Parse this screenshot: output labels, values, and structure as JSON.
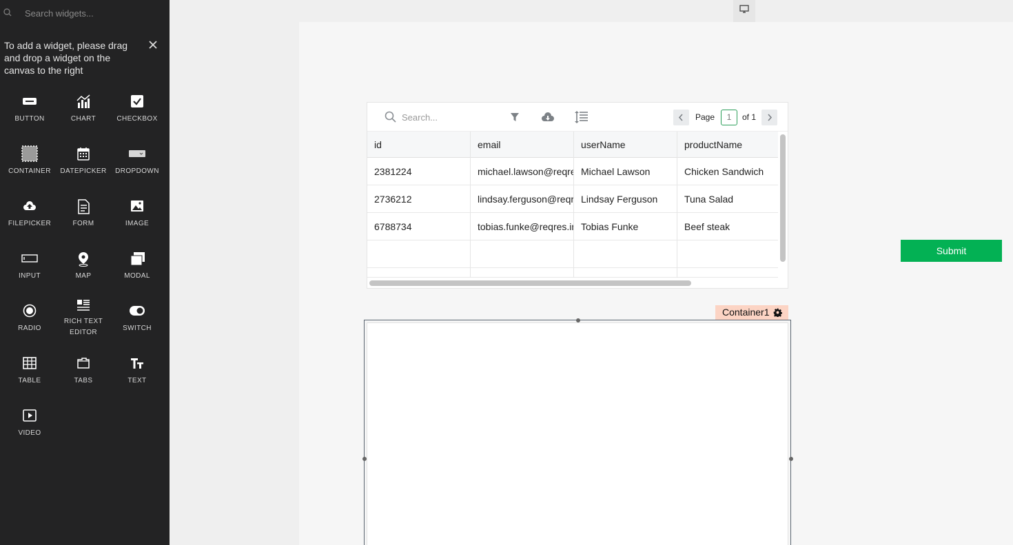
{
  "sidebar": {
    "search_placeholder": "Search widgets...",
    "hint": "To add a widget, please drag and drop a widget on the canvas to the right",
    "widgets": [
      {
        "label": "BUTTON",
        "icon": "button-icon"
      },
      {
        "label": "CHART",
        "icon": "chart-icon"
      },
      {
        "label": "CHECKBOX",
        "icon": "checkbox-icon"
      },
      {
        "label": "CONTAINER",
        "icon": "container-icon"
      },
      {
        "label": "DATEPICKER",
        "icon": "calendar-icon"
      },
      {
        "label": "DROPDOWN",
        "icon": "dropdown-icon"
      },
      {
        "label": "FILEPICKER",
        "icon": "upload-cloud-icon"
      },
      {
        "label": "FORM",
        "icon": "form-icon"
      },
      {
        "label": "IMAGE",
        "icon": "image-icon"
      },
      {
        "label": "INPUT",
        "icon": "input-icon"
      },
      {
        "label": "MAP",
        "icon": "map-pin-icon"
      },
      {
        "label": "MODAL",
        "icon": "modal-icon"
      },
      {
        "label": "RADIO",
        "icon": "radio-icon"
      },
      {
        "label": "RICH TEXT EDITOR",
        "icon": "rich-text-icon"
      },
      {
        "label": "SWITCH",
        "icon": "switch-icon"
      },
      {
        "label": "TABLE",
        "icon": "table-icon"
      },
      {
        "label": "TABS",
        "icon": "tabs-icon"
      },
      {
        "label": "TEXT",
        "icon": "text-icon"
      },
      {
        "label": "VIDEO",
        "icon": "video-icon"
      }
    ]
  },
  "table": {
    "search_placeholder": "Search...",
    "page_label": "Page",
    "page_number": "1",
    "page_of": "of 1",
    "columns": [
      "id",
      "email",
      "userName",
      "productName"
    ],
    "rows": [
      [
        "2381224",
        "michael.lawson@reqres.in",
        "Michael Lawson",
        "Chicken Sandwich"
      ],
      [
        "2736212",
        "lindsay.ferguson@reqres.in",
        "Lindsay Ferguson",
        "Tuna Salad"
      ],
      [
        "6788734",
        "tobias.funke@reqres.in",
        "Tobias Funke",
        "Beef steak"
      ],
      [
        "",
        "",
        "",
        ""
      ]
    ]
  },
  "submit_button": {
    "label": "Submit"
  },
  "container": {
    "name": "Container1"
  },
  "colors": {
    "sidebar_bg": "#232324",
    "accent_green": "#03b154",
    "container_label_bg": "#fcd4c4"
  }
}
